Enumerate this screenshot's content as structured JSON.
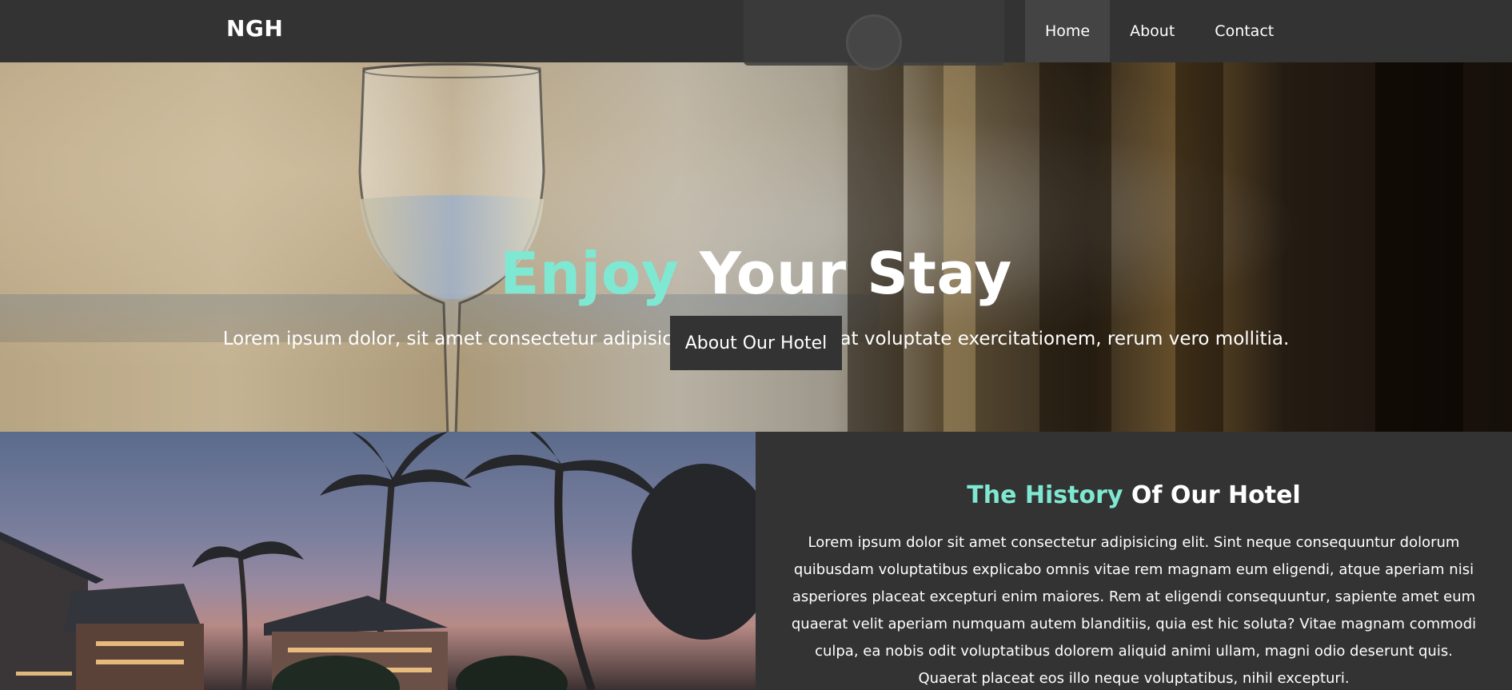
{
  "navbar": {
    "logo": "NGH",
    "links": [
      {
        "label": "Home",
        "active": true
      },
      {
        "label": "About",
        "active": false
      },
      {
        "label": "Contact",
        "active": false
      }
    ]
  },
  "hero": {
    "title_accent": "Enjoy",
    "title_rest": "Your Stay",
    "subtitle": "Lorem ipsum dolor, sit amet consectetur adipisicing elit. Provident at voluptate exercitationem, rerum vero mollitia.",
    "button_label": "About Our Hotel"
  },
  "history": {
    "title_accent": "The History",
    "title_rest": "Of Our Hotel",
    "body": "Lorem ipsum dolor sit amet consectetur adipisicing elit. Sint neque consequuntur dolorum quibusdam voluptatibus explicabo omnis vitae rem magnam eum eligendi, atque aperiam nisi asperiores placeat excepturi enim maiores. Rem at eligendi consequuntur, sapiente amet eum quaerat velit aperiam numquam autem blanditiis, quia est hic soluta? Vitae magnam commodi culpa, ea nobis odit voluptatibus dolorem aliquid animi ullam, magni odio deserunt quis. Quaerat placeat eos illo neque voluptatibus, nihil excepturi."
  },
  "colors": {
    "accent": "#7fe8d2",
    "background": "#333333",
    "nav_active": "#444444"
  }
}
